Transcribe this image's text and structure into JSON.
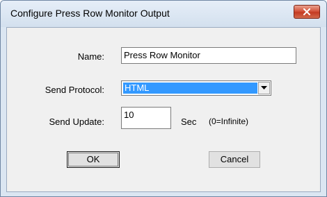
{
  "window": {
    "title": "Configure Press Row Monitor Output"
  },
  "form": {
    "name_label": "Name:",
    "name_value": "Press Row Monitor",
    "protocol_label": "Send Protocol:",
    "protocol_value": "HTML",
    "update_label": "Send Update:",
    "update_value": "10",
    "update_unit": "Sec",
    "update_hint": "(0=Infinite)"
  },
  "buttons": {
    "ok": "OK",
    "cancel": "Cancel"
  },
  "icons": {
    "close": "close-icon",
    "dropdown": "chevron-down-icon"
  },
  "colors": {
    "selection": "#3399ff",
    "close_button": "#c43a22"
  }
}
